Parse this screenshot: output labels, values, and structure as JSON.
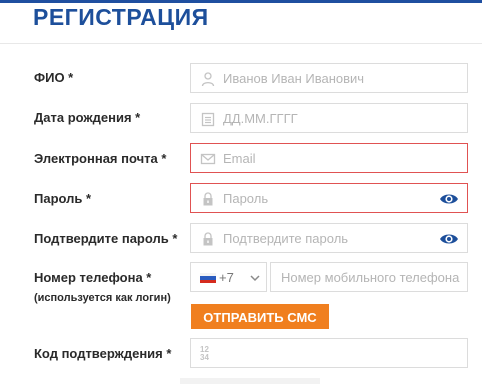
{
  "page": {
    "title": "РЕГИСТРАЦИЯ"
  },
  "form": {
    "full_name": {
      "label": "ФИО *",
      "placeholder": "Иванов Иван Иванович",
      "icon": "user-icon"
    },
    "birth_date": {
      "label": "Дата рождения *",
      "placeholder": "ДД.ММ.ГГГГ",
      "icon": "calendar-icon"
    },
    "email": {
      "label": "Электронная почта *",
      "placeholder": "Email",
      "icon": "envelope-icon",
      "state": "error"
    },
    "password": {
      "label": "Пароль *",
      "placeholder": "Пароль",
      "icon": "lock-icon",
      "state": "error",
      "toggle_icon": "eye-icon"
    },
    "password_confirm": {
      "label": "Подтвердите пароль *",
      "placeholder": "Подтвердите пароль",
      "icon": "lock-icon",
      "toggle_icon": "eye-icon"
    },
    "phone": {
      "label": "Номер телефона *",
      "sublabel": "(используется как логин)",
      "country_code": "+7",
      "country_flag": "russia-flag-icon",
      "placeholder": "Номер мобильного телефона"
    },
    "send_sms_button": "ОТПРАВИТЬ СМС",
    "confirmation_code": {
      "label": "Код подтверждения *",
      "icon": "digits-icon",
      "glyph_top": "12",
      "glyph_bottom": "34"
    }
  },
  "colors": {
    "title": "#1d4f9b",
    "error_border": "#e05252",
    "accent_button": "#f07f1f",
    "eye_icon": "#1d4f9b"
  }
}
